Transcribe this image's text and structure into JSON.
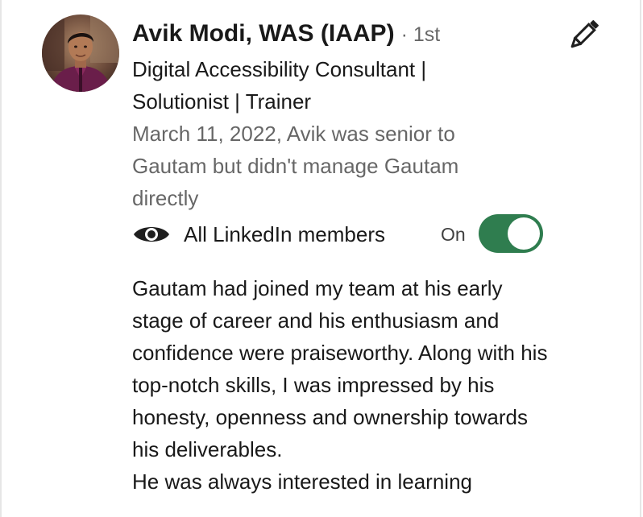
{
  "recommender": {
    "name": "Avik Modi, WAS (IAAP)",
    "degree": "· 1st",
    "headline": "Digital Accessibility Consultant | Solutionist | Trainer",
    "relationship": "March 11, 2022, Avik was senior to Gautam but didn't manage Gautam directly",
    "avatar_icon": "profile-photo"
  },
  "actions": {
    "edit_icon": "pencil-icon"
  },
  "visibility": {
    "icon": "eye-icon",
    "label": "All LinkedIn members",
    "toggle_state": "On",
    "toggle_on": true,
    "toggle_color": "#2f7d4f"
  },
  "recommendation": {
    "paragraph_1": "Gautam had joined my team at his early stage of career and his enthusiasm and confidence were praiseworthy. Along with his top-notch skills, I was impressed by his honesty, openness and ownership towards his deliverables.",
    "paragraph_2": "He was always interested in learning"
  }
}
